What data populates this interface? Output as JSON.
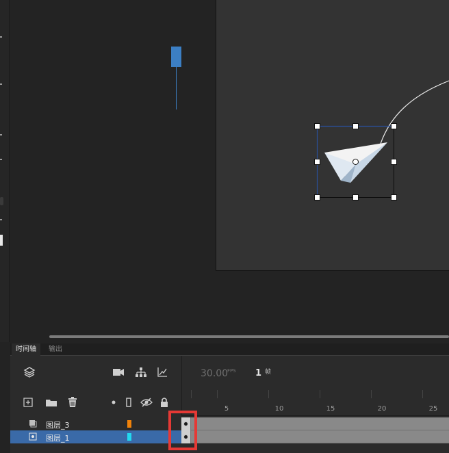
{
  "timeline": {
    "tabs": [
      "时间轴",
      "输出"
    ],
    "fps_value": "30.00",
    "fps_unit": "FPS",
    "current_frame": "1",
    "frame_unit": "帧",
    "ruler_labels": [
      "5",
      "10",
      "15",
      "20",
      "25"
    ]
  },
  "layers": [
    {
      "name": "图层_3",
      "color": "#f0820a",
      "selected": false
    },
    {
      "name": "图层_1",
      "color": "#22d9f0",
      "selected": true
    }
  ],
  "colors": {
    "stage": "#333333",
    "selection": "#2d4a7a",
    "playhead": "#3c7fc4",
    "highlight": "#e53935"
  },
  "icons": {
    "layers": "layers-icon",
    "camera": "camera-icon",
    "parenting": "hierarchy-icon",
    "graph": "graph-icon",
    "add_layer": "add-layer-icon",
    "folder": "folder-icon",
    "delete": "trash-icon",
    "dot": "dot-icon",
    "outline": "outline-icon",
    "visibility": "eye-hidden-icon",
    "lock": "lock-icon"
  }
}
